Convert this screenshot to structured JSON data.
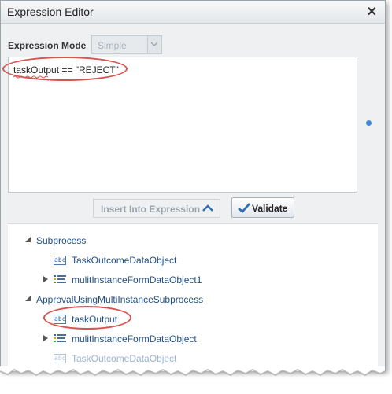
{
  "dialog": {
    "title": "Expression Editor",
    "close_glyph": "✕"
  },
  "mode": {
    "label": "Expression Mode",
    "selected": "Simple"
  },
  "editor": {
    "expression": "taskOutput == \"REJECT\""
  },
  "buttons": {
    "insert_label": "Insert Into Expression",
    "validate_label": "Validate"
  },
  "tree": {
    "nodes": [
      {
        "label": "Subprocess"
      },
      {
        "label": "TaskOutcomeDataObject"
      },
      {
        "label": "mulitInstanceFormDataObject1"
      },
      {
        "label": "ApprovalUsingMultiInstanceSubprocess"
      },
      {
        "label": "taskOutput"
      },
      {
        "label": "mulitInstanceFormDataObject"
      },
      {
        "label": "TaskOutcomeDataObject"
      }
    ],
    "abc_icon": "abc"
  },
  "colors": {
    "highlight": "#d9534f",
    "link": "#1f4f86",
    "accent": "#3a8ad9"
  }
}
